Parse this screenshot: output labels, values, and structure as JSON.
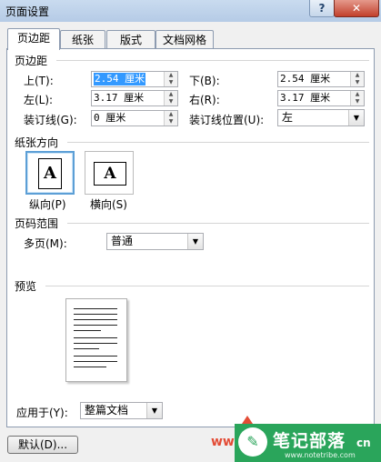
{
  "window": {
    "title": "页面设置",
    "help_label": "?",
    "close_label": "✕"
  },
  "tabs": [
    "页边距",
    "纸张",
    "版式",
    "文档网格"
  ],
  "margins": {
    "group_title": "页边距",
    "top_label": "上(T):",
    "top_value": "2.54 厘米",
    "bottom_label": "下(B):",
    "bottom_value": "2.54 厘米",
    "left_label": "左(L):",
    "left_value": "3.17 厘米",
    "right_label": "右(R):",
    "right_value": "3.17 厘米",
    "gutter_label": "装订线(G):",
    "gutter_value": "0 厘米",
    "gutter_pos_label": "装订线位置(U):",
    "gutter_pos_value": "左"
  },
  "orientation": {
    "group_title": "纸张方向",
    "portrait_label": "纵向(P)",
    "landscape_label": "横向(S)",
    "icon_letter": "A"
  },
  "pages": {
    "group_title": "页码范围",
    "multiple_label": "多页(M):",
    "multiple_value": "普通"
  },
  "preview": {
    "group_title": "预览",
    "apply_label": "应用于(Y):",
    "apply_value": "整篇文档"
  },
  "footer": {
    "default_button": "默认(D)..."
  },
  "watermark": {
    "url_text": "www",
    "title": "笔记部落",
    "suffix": "cn",
    "sub": "www.notetribe.com"
  }
}
